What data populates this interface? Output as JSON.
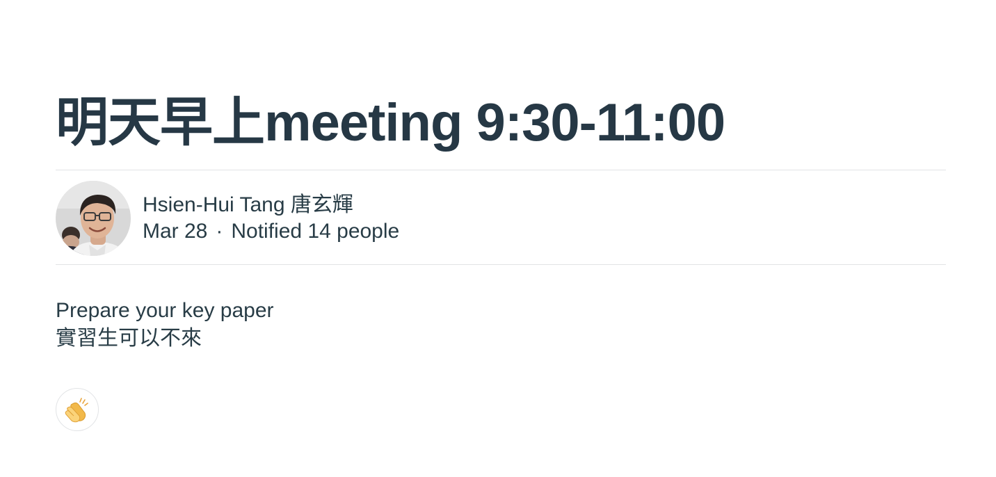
{
  "message": {
    "title": "明天早上meeting 9:30-11:00",
    "author": {
      "name": "Hsien-Hui Tang 唐玄輝",
      "avatar": "avatar-photo"
    },
    "date": "Mar 28",
    "separator": "·",
    "notified": "Notified 14 people",
    "body": [
      "Prepare your key paper",
      "實習生可以不來"
    ]
  },
  "reactions": {
    "icon": "clapping-hands-icon"
  }
}
